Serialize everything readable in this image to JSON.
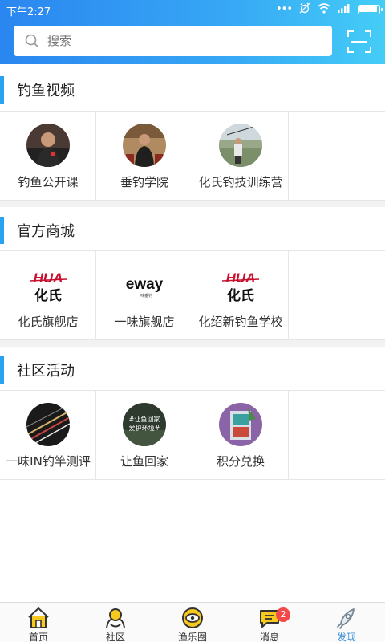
{
  "status_bar": {
    "time": "下午2:27",
    "dots": "•••"
  },
  "search": {
    "placeholder": "搜索"
  },
  "sections": [
    {
      "title": "钓鱼视频",
      "items": [
        {
          "label": "钓鱼公开课"
        },
        {
          "label": "垂钓学院"
        },
        {
          "label": "化氏钓技训练营"
        }
      ]
    },
    {
      "title": "官方商城",
      "items": [
        {
          "label": "化氏旗舰店",
          "logo_top": "HUA",
          "logo_bottom": "化氏"
        },
        {
          "label": "一味旗舰店",
          "logo_top": "eway",
          "logo_bottom": "一味垂钓"
        },
        {
          "label": "化绍新钓鱼学校",
          "logo_top": "HUA",
          "logo_bottom": "化氏"
        }
      ]
    },
    {
      "title": "社区活动",
      "items": [
        {
          "label": "一味IN钓竿测评"
        },
        {
          "label": "让鱼回家",
          "image_text_1": "#让鱼回家",
          "image_text_2": "爱护环境#"
        },
        {
          "label": "积分兑换"
        }
      ]
    }
  ],
  "bottom_nav": [
    {
      "label": "首页",
      "icon": "home-icon"
    },
    {
      "label": "社区",
      "icon": "community-icon"
    },
    {
      "label": "渔乐圈",
      "icon": "fish-circle-icon"
    },
    {
      "label": "消息",
      "icon": "message-icon",
      "badge": "2"
    },
    {
      "label": "发现",
      "icon": "rocket-icon",
      "active": true
    }
  ],
  "colors": {
    "accent": "#2aa2f2",
    "header_start": "#2a86f0",
    "header_end": "#44cdf6",
    "nav_active": "#3a8fd6",
    "badge": "#f24a4a",
    "brand_red": "#c8102e"
  }
}
